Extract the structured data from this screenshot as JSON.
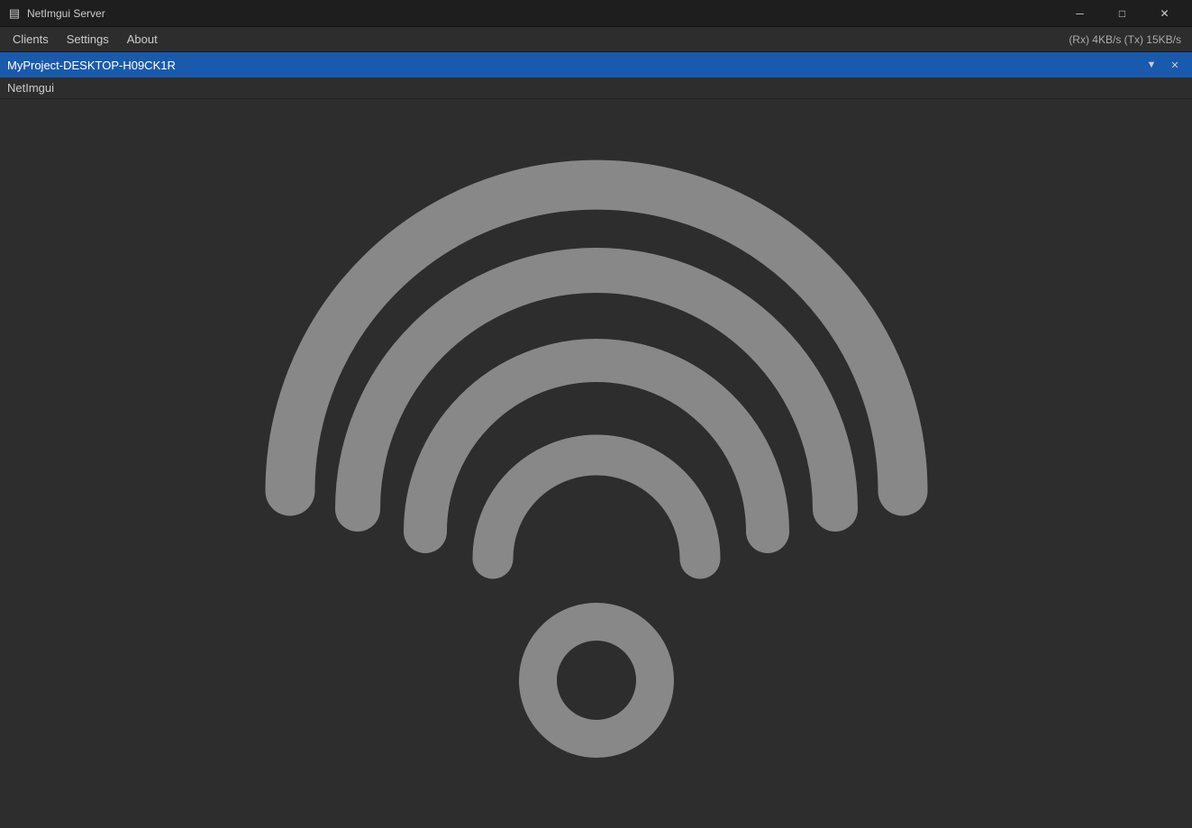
{
  "titlebar": {
    "icon": "▤",
    "title": "NetImgui Server",
    "minimize_label": "─",
    "maximize_label": "□",
    "close_label": "✕"
  },
  "menubar": {
    "items": [
      {
        "id": "clients",
        "label": "Clients"
      },
      {
        "id": "settings",
        "label": "Settings"
      },
      {
        "id": "about",
        "label": "About"
      }
    ],
    "status": "(Rx) 4KB/s  (Tx) 15KB/s"
  },
  "client_panel": {
    "title": "MyProject-DESKTOP-H09CK1R",
    "filter_label": "▼",
    "close_label": "✕",
    "sub_title": "NetImgui"
  },
  "wifi_icon": {
    "color": "#888888",
    "bg_color": "#2d2d2d"
  }
}
